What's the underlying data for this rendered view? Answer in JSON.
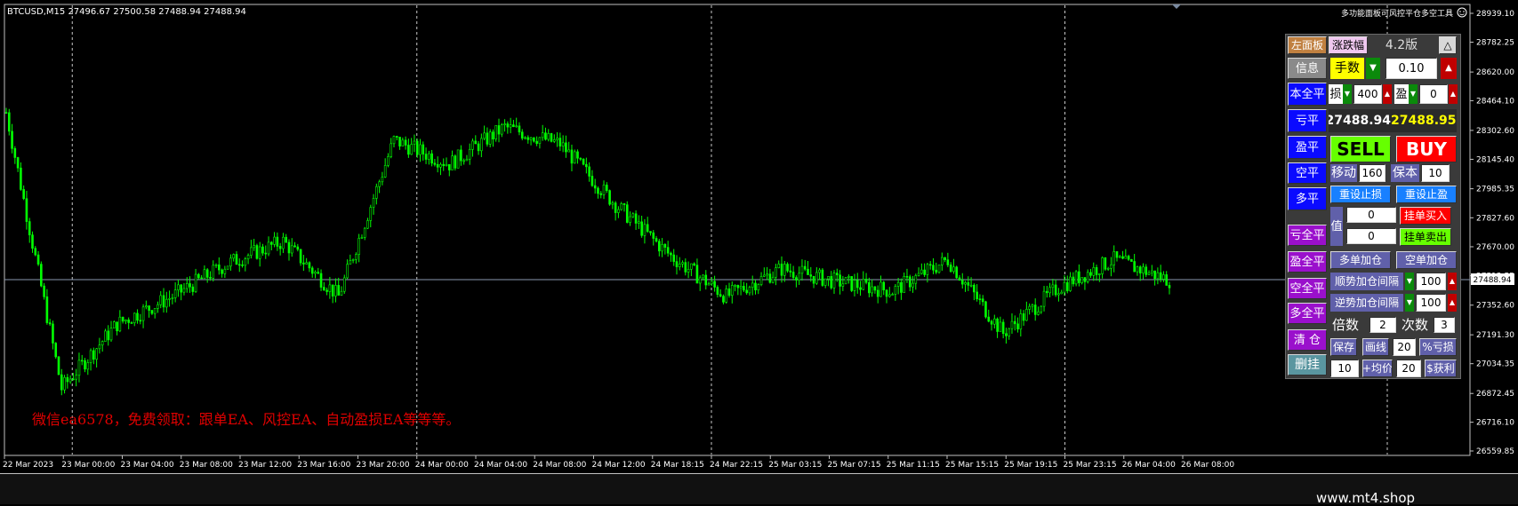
{
  "chart": {
    "header": "BTCUSD,M15  27496.67 27500.58 27488.94 27488.94",
    "top_right_text": "多功能面板可风控平仓多空工具",
    "current_price_label": "27488.94",
    "promo_text": "微信ea6578，免费领取：跟单EA、风控EA、自动盈损EA等等等。",
    "price_ticks": [
      "28939.10",
      "28782.25",
      "28620.00",
      "28464.10",
      "28302.60",
      "28145.40",
      "27985.35",
      "27827.60",
      "27670.00",
      "27512.55",
      "27352.60",
      "27191.30",
      "27034.35",
      "26872.45",
      "26716.10",
      "26559.85"
    ],
    "time_ticks": [
      "22 Mar 2023",
      "23 Mar 00:00",
      "23 Mar 04:00",
      "23 Mar 08:00",
      "23 Mar 12:00",
      "23 Mar 16:00",
      "23 Mar 20:00",
      "24 Mar 00:00",
      "24 Mar 04:00",
      "24 Mar 08:00",
      "24 Mar 12:00",
      "24 Mar 18:15",
      "24 Mar 22:15",
      "25 Mar 03:15",
      "25 Mar 07:15",
      "25 Mar 11:15",
      "25 Mar 15:15",
      "25 Mar 19:15",
      "25 Mar 23:15",
      "26 Mar 04:00",
      "26 Mar 08:00"
    ]
  },
  "chart_data": {
    "type": "candlestick",
    "symbol": "BTCUSD",
    "timeframe": "M15",
    "ohlc_header": [
      27496.67,
      27500.58,
      27488.94,
      27488.94
    ],
    "current_price": 27488.94,
    "ylim": [
      26559.85,
      28939.1
    ],
    "x": [
      "22 Mar 2023",
      "23 Mar 00:00",
      "23 Mar 04:00",
      "23 Mar 08:00",
      "23 Mar 12:00",
      "23 Mar 16:00",
      "23 Mar 20:00",
      "24 Mar 00:00",
      "24 Mar 04:00",
      "24 Mar 08:00",
      "24 Mar 12:00",
      "24 Mar 18:15",
      "24 Mar 22:15",
      "25 Mar 03:15",
      "25 Mar 07:15",
      "25 Mar 11:15",
      "25 Mar 15:15",
      "25 Mar 19:15",
      "25 Mar 23:15",
      "26 Mar 04:00",
      "26 Mar 08:00"
    ],
    "close": [
      28400,
      26900,
      27250,
      27400,
      27580,
      27700,
      27400,
      28250,
      28120,
      28320,
      28230,
      27900,
      27620,
      27400,
      27550,
      27480,
      27430,
      27600,
      27200,
      27450,
      27600,
      27488.94
    ],
    "colors": {
      "candle": "#00ff00",
      "background": "#000000",
      "grid": "#c8c8c8",
      "text": "#ffffff"
    },
    "grid": true
  },
  "panel": {
    "left_panel": "左面板",
    "change": "涨跌幅",
    "version": "4.2版",
    "collapse": "△",
    "info": "信息",
    "lots_label": "手数",
    "lots_value": "0.10",
    "close_all_principal": "本全平",
    "sl_label": "损",
    "sl_value": "400",
    "tp_label": "盈",
    "tp_value": "0",
    "close_loss": "亏平",
    "bid": "27488.94",
    "ask": "27488.95",
    "close_profit": "盈平",
    "sell": "SELL",
    "buy": "BUY",
    "close_short": "空平",
    "trail_label": "移动",
    "trail_value": "160",
    "breakeven_label": "保本",
    "breakeven_value": "10",
    "reset_sl": "重设止损",
    "reset_tp": "重设止盈",
    "close_long": "多平",
    "value_label": "值",
    "pending_buy_value": "0",
    "pending_buy": "挂单买入",
    "pending_sell_value": "0",
    "pending_sell": "挂单卖出",
    "close_all_loss": "亏全平",
    "close_all_profit": "盈全平",
    "add_long": "多单加仓",
    "add_short": "空单加仓",
    "close_all_short": "空全平",
    "trend_add_label": "顺势加仓间隔",
    "trend_add_value": "100",
    "close_all_long": "多全平",
    "counter_add_label": "逆势加仓间隔",
    "counter_add_value": "100",
    "clear_positions": "清 仓",
    "multiplier_label": "倍数",
    "multiplier_value": "2",
    "count_label": "次数",
    "count_value": "3",
    "save": "保存",
    "draw_line": "画线",
    "draw_value": "20",
    "pct_loss": "%亏损",
    "delete_pending": "删挂",
    "delete_value": "10",
    "avg_price": "+均价",
    "avg_value": "20",
    "dollar_profit": "$获利"
  },
  "footer": {
    "site": "www.mt4.shop"
  }
}
